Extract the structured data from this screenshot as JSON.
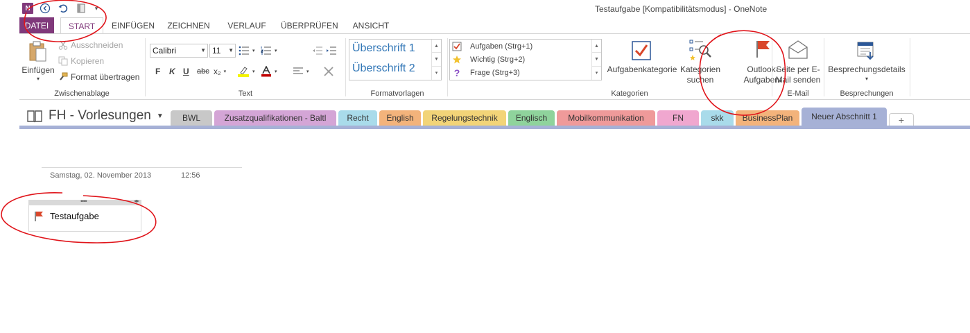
{
  "window": {
    "title": "Testaufgabe [Kompatibilitätsmodus] - OneNote",
    "app_icon_text": "N"
  },
  "qat": {
    "icons": [
      "back-icon",
      "undo-icon",
      "page-icon",
      "qat-more-icon"
    ]
  },
  "ribbon_tabs": [
    {
      "label": "DATEI"
    },
    {
      "label": "START"
    },
    {
      "label": "EINFÜGEN"
    },
    {
      "label": "ZEICHNEN"
    },
    {
      "label": "VERLAUF"
    },
    {
      "label": "ÜBERPRÜFEN"
    },
    {
      "label": "ANSICHT"
    }
  ],
  "clipboard": {
    "label": "Zwischenablage",
    "paste": "Einfügen",
    "cut": "Ausschneiden",
    "copy": "Kopieren",
    "format_painter": "Format übertragen"
  },
  "text": {
    "label": "Text",
    "font": "Calibri",
    "size": "11",
    "bold": "F",
    "italic": "K",
    "underline": "U",
    "strike": "abc",
    "subscript": "x₂"
  },
  "styles": {
    "label": "Formatvorlagen",
    "heading1": "Überschrift 1",
    "heading2": "Überschrift 2"
  },
  "tags": {
    "label": "Kategorien",
    "items": [
      {
        "label": "Aufgaben (Strg+1)"
      },
      {
        "label": "Wichtig (Strg+2)"
      },
      {
        "label": "Frage (Strg+3)"
      }
    ],
    "todo_tag": "Aufgabenkategorie",
    "find_tags_line1": "Kategorien",
    "find_tags_line2": "suchen",
    "outlook_line1": "Outlook-",
    "outlook_line2": "Aufgaben"
  },
  "email": {
    "label": "E-Mail",
    "line1": "Seite per E-",
    "line2": "Mail senden"
  },
  "meetings": {
    "label": "Besprechungen",
    "details": "Besprechungsdetails"
  },
  "notebook": {
    "name": "FH - Vorlesungen",
    "sections": [
      {
        "label": "BWL",
        "color": "#c8c8c8"
      },
      {
        "label": "Zusatzqualifikationen - Baltl",
        "color": "#d4a5d6"
      },
      {
        "label": "Recht",
        "color": "#a9dbea"
      },
      {
        "label": "English",
        "color": "#f3b37b"
      },
      {
        "label": "Regelungstechnik",
        "color": "#f2d478"
      },
      {
        "label": "Englisch",
        "color": "#8fd39c"
      },
      {
        "label": "Mobilkommunikation",
        "color": "#ef9a9a"
      },
      {
        "label": "FN",
        "color": "#f0a7cf"
      },
      {
        "label": "skk",
        "color": "#a9dbea"
      },
      {
        "label": "BusinessPlan",
        "color": "#f3b37b"
      },
      {
        "label": "Neuer Abschnitt 1",
        "color": "#a6b1d6"
      }
    ],
    "add_tab": "+"
  },
  "page": {
    "date": "Samstag, 02. November 2013",
    "time": "12:56",
    "note_text": "Testaufgabe"
  },
  "colors": {
    "onenote_purple": "#80397b",
    "annotation_red": "#e0141a",
    "tag_flag": "#d9472b",
    "todo_check": "#d9472b"
  }
}
